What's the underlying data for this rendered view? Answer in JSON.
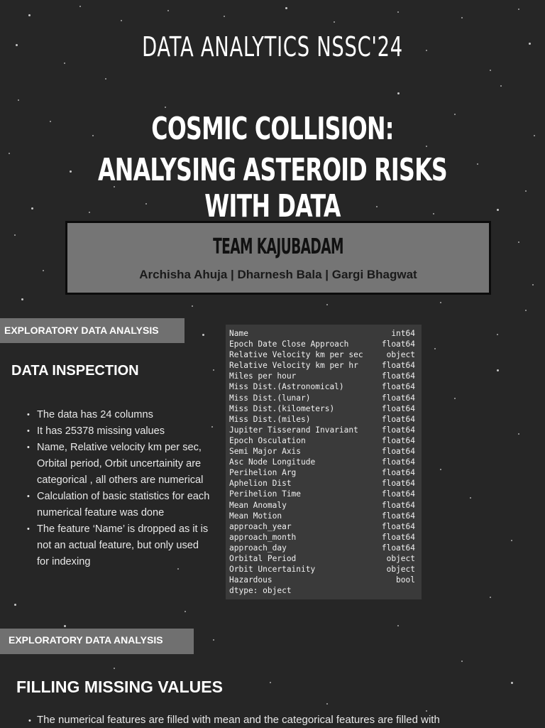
{
  "header": {
    "title": "Data Analytics NSSC'24",
    "subtitle_line1": "Cosmic Collision:",
    "subtitle_line2": "Analysing Asteroid Risks with Data"
  },
  "team": {
    "name": "Team Kajubadam",
    "members": "Archisha Ahuja | Dharnesh Bala | Gargi Bhagwat"
  },
  "section1": {
    "tag": "EXPLORATORY DATA ANALYSIS",
    "heading": "DATA INSPECTION",
    "bullets": [
      "The data has 24 columns",
      "It has 25378 missing values",
      "Name, Relative velocity km per sec, Orbital period, Orbit uncertainity are categorical , all others are numerical",
      "Calculation of basic statistics for each numerical feature was done",
      "The feature ‘Name’ is dropped as it is not an actual feature, but only used for indexing"
    ]
  },
  "dtypes": {
    "rows": [
      [
        "Name",
        "int64"
      ],
      [
        "Epoch Date Close Approach",
        "float64"
      ],
      [
        "Relative Velocity km per sec",
        "object"
      ],
      [
        "Relative Velocity km per hr",
        "float64"
      ],
      [
        "Miles per hour",
        "float64"
      ],
      [
        "Miss Dist.(Astronomical)",
        "float64"
      ],
      [
        "Miss Dist.(lunar)",
        "float64"
      ],
      [
        "Miss Dist.(kilometers)",
        "float64"
      ],
      [
        "Miss Dist.(miles)",
        "float64"
      ],
      [
        "Jupiter Tisserand Invariant",
        "float64"
      ],
      [
        "Epoch Osculation",
        "float64"
      ],
      [
        "Semi Major Axis",
        "float64"
      ],
      [
        "Asc Node Longitude",
        "float64"
      ],
      [
        "Perihelion Arg",
        "float64"
      ],
      [
        "Aphelion Dist",
        "float64"
      ],
      [
        "Perihelion Time",
        "float64"
      ],
      [
        "Mean Anomaly",
        "float64"
      ],
      [
        "Mean Motion",
        "float64"
      ],
      [
        "approach_year",
        "float64"
      ],
      [
        "approach_month",
        "float64"
      ],
      [
        "approach_day",
        "float64"
      ],
      [
        "Orbital Period",
        "object"
      ],
      [
        "Orbit Uncertainity",
        "object"
      ],
      [
        "Hazardous",
        "bool"
      ]
    ],
    "footer": "dtype: object"
  },
  "section2": {
    "tag": "EXPLORATORY DATA ANALYSIS",
    "heading": "FILLING MISSING VALUES",
    "bullet": "The numerical features are filled with mean and the categorical features are filled with"
  },
  "colors": {
    "background": "#262626",
    "tag_background": "#707070",
    "team_box": "#757575",
    "code_panel": "#3a3a3a"
  }
}
